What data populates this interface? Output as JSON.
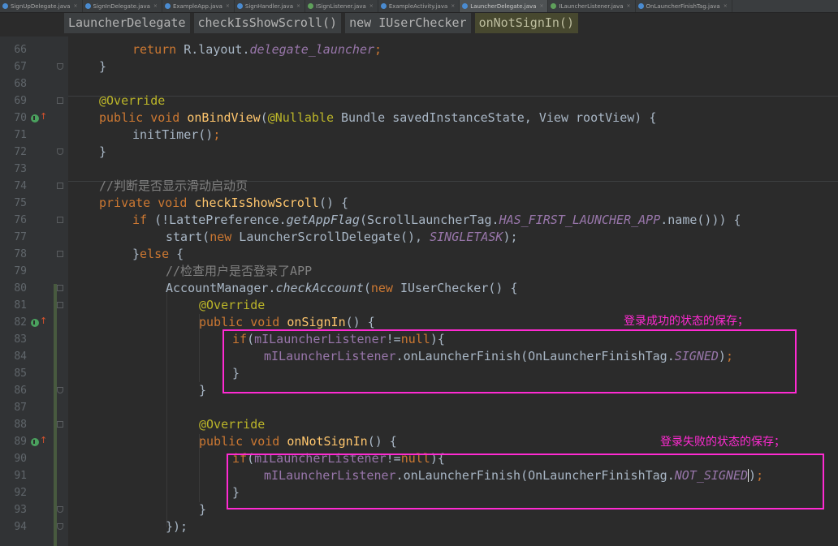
{
  "file_tabs": [
    {
      "name": "SignUpDelegate.java",
      "icon": "c",
      "active": false
    },
    {
      "name": "SignInDelegate.java",
      "icon": "c",
      "active": false
    },
    {
      "name": "ExampleApp.java",
      "icon": "c",
      "active": false
    },
    {
      "name": "SignHandler.java",
      "icon": "c",
      "active": false
    },
    {
      "name": "ISignListener.java",
      "icon": "i",
      "active": false
    },
    {
      "name": "ExampleActivity.java",
      "icon": "c",
      "active": false
    },
    {
      "name": "LauncherDelegate.java",
      "icon": "c",
      "active": true
    },
    {
      "name": "ILauncherListener.java",
      "icon": "i",
      "active": false
    },
    {
      "name": "OnLauncherFinishTag.java",
      "icon": "c",
      "active": false
    }
  ],
  "breadcrumb": [
    "LauncherDelegate",
    "checkIsShowScroll()",
    "new IUserChecker",
    "onNotSignIn()"
  ],
  "line_numbers": [
    "66",
    "67",
    "68",
    "69",
    "70",
    "71",
    "72",
    "73",
    "74",
    "75",
    "76",
    "77",
    "78",
    "79",
    "80",
    "81",
    "82",
    "83",
    "84",
    "85",
    "86",
    "87",
    "88",
    "89",
    "90",
    "91",
    "92",
    "93",
    "94"
  ],
  "code": {
    "l66": {
      "kw": "return",
      "t1": " R.layout.",
      "fld": "delegate_launcher",
      "t2": ";"
    },
    "l67": "}",
    "l69": "@Override",
    "l70": {
      "kw1": "public void ",
      "fn": "onBindView",
      "t1": "(",
      "ann": "@Nullable",
      "t2": " Bundle savedInstanceState, View rootView) {"
    },
    "l71": {
      "t1": "initTimer()",
      "t2": ";"
    },
    "l72": "}",
    "l74": "//判断是否显示滑动启动页",
    "l75": {
      "kw": "private void ",
      "fn": "checkIsShowScroll",
      "t": "() {"
    },
    "l76": {
      "kw": "if",
      "t1": " (!LattePreference.",
      "it": "getAppFlag",
      "t2": "(ScrollLauncherTag.",
      "st": "HAS_FIRST_LAUNCHER_APP",
      "t3": ".name())) {"
    },
    "l77": {
      "t1": "start(",
      "kw": "new",
      "t2": " LauncherScrollDelegate(), ",
      "st": "SINGLETASK",
      "t3": ");"
    },
    "l78": {
      "t1": "}",
      "kw": "else",
      "t2": " {"
    },
    "l79": "//检查用户是否登录了APP",
    "l80": {
      "t1": "AccountManager.",
      "it": "checkAccount",
      "t2": "(",
      "kw": "new",
      "t3": " IUserChecker() {"
    },
    "l81": "@Override",
    "l82": {
      "kw": "public void ",
      "fn": "onSignIn",
      "t": "() {"
    },
    "l83": {
      "kw": "if",
      "t1": "(",
      "fld": "mILauncherListener",
      "t2": "!=",
      "kw2": "null",
      "t3": "){"
    },
    "l84": {
      "fld": "mILauncherListener",
      "t1": ".onLauncherFinish(OnLauncherFinishTag.",
      "st": "SIGNED",
      "t2": ")",
      "t3": ";"
    },
    "l85": "}",
    "l86": "}",
    "l88": "@Override",
    "l89": {
      "kw": "public void ",
      "fn": "onNotSignIn",
      "t": "() {"
    },
    "l90": {
      "kw": "if",
      "t1": "(",
      "fld": "mILauncherListener",
      "t2": "!=",
      "kw2": "null",
      "t3": "){"
    },
    "l91": {
      "fld": "mILauncherListener",
      "t1": ".onLauncherFinish(OnLauncherFinishTag.",
      "st": "NOT_SIGNED",
      "t2": ")",
      "t3": ";"
    },
    "l92": "}",
    "l93": "}",
    "l94": "});"
  },
  "annotations": {
    "signin_note": "登录成功的状态的保存；",
    "notsignin_note": "登录失败的状态的保存；"
  },
  "colors": {
    "highlight": "#ff2ad2",
    "keyword": "#cc7832",
    "annotation": "#bbb529",
    "method": "#ffc66d",
    "static_field": "#9876aa",
    "comment": "#808080"
  }
}
